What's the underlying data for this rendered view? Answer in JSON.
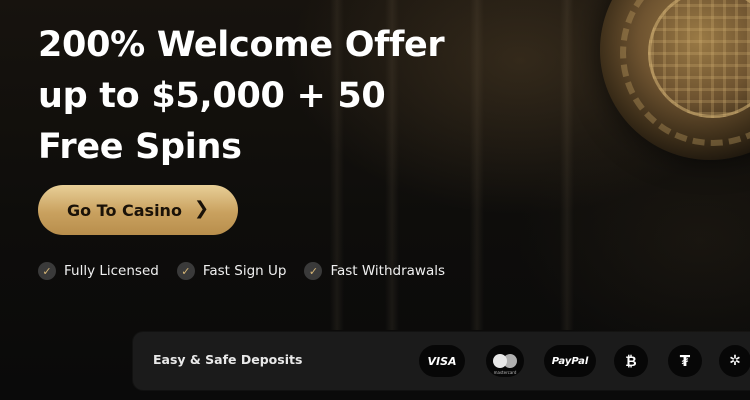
{
  "hero": {
    "headline_lines": [
      "200% Welcome Offer",
      "up to $5,000 + 50",
      "Free Spins"
    ],
    "cta_label": "Go To Casino",
    "cta_icon": "chevron-right-icon"
  },
  "features": [
    {
      "label": "Fully Licensed",
      "icon": "check-icon"
    },
    {
      "label": "Fast Sign Up",
      "icon": "check-icon"
    },
    {
      "label": "Fast Withdrawals",
      "icon": "check-icon"
    }
  ],
  "deposits": {
    "label": "Easy & Safe Deposits",
    "methods": [
      {
        "name": "visa",
        "text": "VISA",
        "icon": "visa-icon"
      },
      {
        "name": "mastercard",
        "text": "mastercard",
        "icon": "mastercard-icon"
      },
      {
        "name": "paypal",
        "text": "PayPal",
        "icon": "paypal-icon"
      },
      {
        "name": "bitcoin",
        "text": "₿",
        "icon": "bitcoin-icon"
      },
      {
        "name": "tether",
        "text": "₮",
        "icon": "tether-icon"
      },
      {
        "name": "cardano",
        "text": "✲",
        "icon": "cardano-icon"
      }
    ]
  },
  "colors": {
    "accent_gold": "#d6b676",
    "background": "#0b0b0b",
    "panel": "#1b1b1b"
  }
}
